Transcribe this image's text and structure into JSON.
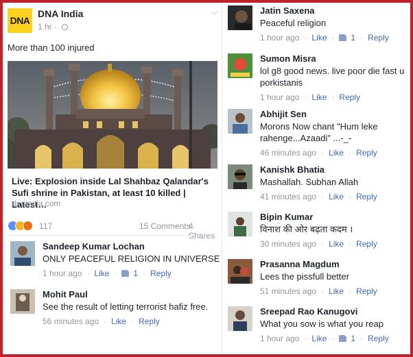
{
  "post": {
    "page_logo_text": "DNA",
    "page_name": "DNA India",
    "time": "1 hr",
    "privacy_icon": "globe-icon",
    "menu_icon": "chevron-down-icon",
    "text": "More than 100 injured",
    "link": {
      "title": "Live: Explosion inside Lal Shahbaz Qalandar's Sufi shrine in Pakistan, at least 10 killed | Latest…",
      "domain": "dnaindia.com"
    },
    "reactions": {
      "icons": [
        "like-reaction-icon",
        "haha-reaction-icon",
        "angry-reaction-icon"
      ],
      "count": "117",
      "comments": "15 Comments",
      "shares": "4 Shares"
    }
  },
  "labels": {
    "like": "Like",
    "reply": "Reply"
  },
  "colors": {
    "brand_yellow": "#ffd21f",
    "frame_red": "#c0202a",
    "link_blue": "#4267b2",
    "meta_gray": "#90949c"
  },
  "left_comments": [
    {
      "name": "Sandeep Kumar Lochan",
      "text": "ONLY PEACEFUL RELIGION IN UNIVERSE",
      "time": "1 hour ago",
      "likes": "1"
    },
    {
      "name": "Mohit Paul",
      "text": "See the result of letting terrorist hafiz free.",
      "time": "56 minutes ago",
      "likes": ""
    }
  ],
  "right_comments": [
    {
      "name": "Jatin Saxena",
      "text": "Peaceful religion",
      "time": "1 hour ago",
      "likes": "1"
    },
    {
      "name": "Sumon Misra",
      "text": "lol g8 good news. live poor die fast u porkistanis",
      "time": "1 hour ago",
      "likes": ""
    },
    {
      "name": "Abhijit Sen",
      "text": "Morons Now chant \"Hum leke rahenge...Azaadi\" ...-_-",
      "time": "46 minutes ago",
      "likes": ""
    },
    {
      "name": "Kanishk Bhatia",
      "text": "Mashallah. Subhan Allah",
      "time": "41 minutes ago",
      "likes": ""
    },
    {
      "name": "Bipin Kumar",
      "text": "विनाश की ओर बढ़ता कदम ।",
      "time": "30 minutes ago",
      "likes": ""
    },
    {
      "name": "Prasanna Magdum",
      "text": "Lees the pissfull better",
      "time": "51 minutes ago",
      "likes": ""
    },
    {
      "name": "Sreepad Rao Kanugovi",
      "text": "What you sow is what you reap",
      "time": "1 hour ago",
      "likes": "1"
    }
  ]
}
